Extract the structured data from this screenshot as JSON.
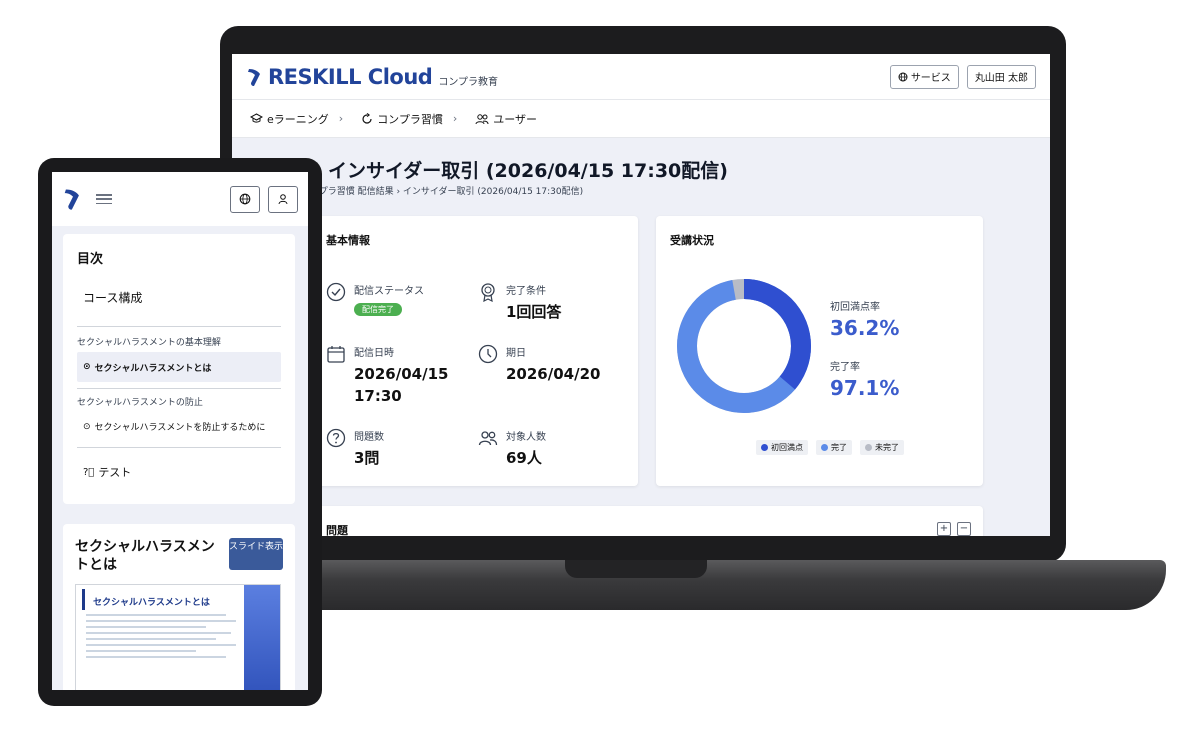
{
  "laptop": {
    "brand": "RESKILL Cloud",
    "brand_sub": "コンプラ教育",
    "header_buttons": {
      "service": "サービス",
      "user": "丸山田 太郎"
    },
    "nav": [
      {
        "label": "eラーニング"
      },
      {
        "label": "コンプラ習慣"
      },
      {
        "label": "ユーザー"
      }
    ],
    "page_title": "インサイダー取引 (2026/04/15 17:30配信)",
    "breadcrumb": "ンプラ習慣 配信結果  ›  インサイダー取引 (2026/04/15 17:30配信)",
    "info_card": {
      "title": "基本情報",
      "status_label": "配信ステータス",
      "status_badge": "配信完了",
      "completion_label": "完了条件",
      "completion_value": "1回回答",
      "date_label": "配信日時",
      "date_value_line1": "2026/04/15",
      "date_value_line2": "17:30",
      "due_label": "期日",
      "due_value": "2026/04/20",
      "questions_label": "問題数",
      "questions_value": "3問",
      "targets_label": "対象人数",
      "targets_value": "69人"
    },
    "status_card": {
      "title": "受講状況",
      "first_full_label": "初回満点率",
      "first_full_value": "36.2%",
      "complete_label": "完了率",
      "complete_value": "97.1%",
      "legend": [
        {
          "label": "初回満点",
          "color": "#2f4fd0"
        },
        {
          "label": "完了",
          "color": "#5b8be8"
        },
        {
          "label": "未完了",
          "color": "#b8bcc6"
        }
      ],
      "donut": {
        "first_full": 36.2,
        "complete": 97.1
      }
    },
    "question_card": {
      "title": "問題",
      "expand": "+",
      "collapse": "−"
    }
  },
  "tablet": {
    "toc": {
      "title": "目次",
      "course": "コース構成",
      "section1": "セクシャルハラスメントの基本理解",
      "item1": "セクシャルハラスメントとは",
      "section2": "セクシャルハラスメントの防止",
      "item2": "セクシャルハラスメントを防止するために",
      "test": "テスト"
    },
    "slide": {
      "title": "セクシャルハラスメントとは",
      "button": "スライド表示",
      "thumb_title": "セクシャルハラスメントとは"
    }
  }
}
